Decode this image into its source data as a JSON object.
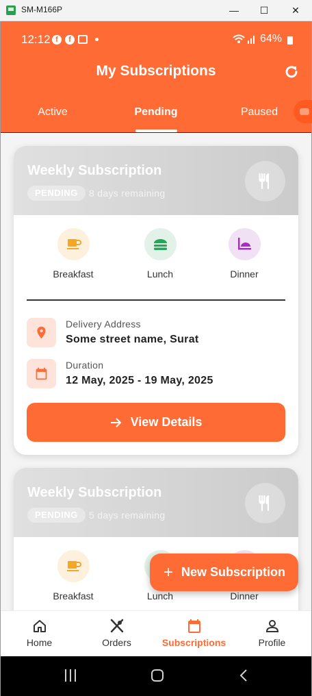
{
  "window": {
    "title": "SM-M166P",
    "minimize": "—",
    "maximize": "☐",
    "close": "✕"
  },
  "status_bar": {
    "time": "12:12",
    "battery": "64%"
  },
  "header": {
    "title": "My Subscriptions"
  },
  "tabs": [
    {
      "label": "Active"
    },
    {
      "label": "Pending"
    },
    {
      "label": "Paused"
    }
  ],
  "cards": [
    {
      "title": "Weekly Subscription",
      "status": "PENDING",
      "remaining": "8 days remaining",
      "meals": [
        {
          "label": "Breakfast"
        },
        {
          "label": "Lunch"
        },
        {
          "label": "Dinner"
        }
      ],
      "address_label": "Delivery Address",
      "address_value": "Some street name, Surat",
      "duration_label": "Duration",
      "duration_value": "12 May, 2025 - 19 May, 2025",
      "button_label": "View Details"
    },
    {
      "title": "Weekly Subscription",
      "status": "PENDING",
      "remaining": "5 days remaining",
      "meals": [
        {
          "label": "Breakfast"
        },
        {
          "label": "Lunch"
        },
        {
          "label": "Dinner"
        }
      ]
    }
  ],
  "fab": {
    "label": "New Subscription"
  },
  "bottom_nav": [
    {
      "label": "Home",
      "icon": "home-icon"
    },
    {
      "label": "Orders",
      "icon": "fork-knife-icon"
    },
    {
      "label": "Subscriptions",
      "icon": "calendar-icon",
      "active": true
    },
    {
      "label": "Profile",
      "icon": "person-icon"
    }
  ],
  "colors": {
    "accent": "#ff6b35",
    "breakfast": "#f5a623",
    "lunch": "#27a55a",
    "dinner": "#a233b8"
  }
}
